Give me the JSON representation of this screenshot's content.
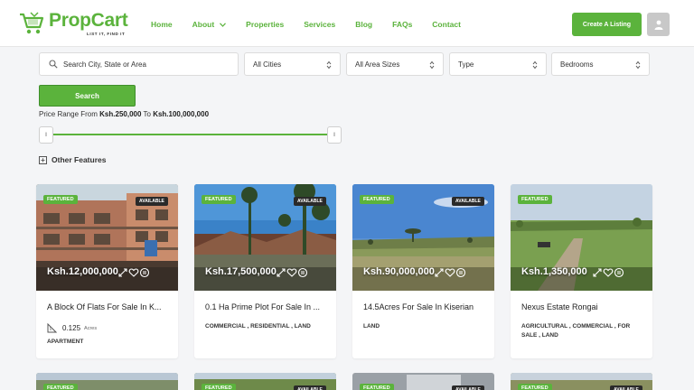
{
  "header": {
    "brand": "PropCart",
    "tagline": "LIST IT, FIND IT",
    "nav": [
      {
        "label": "Home"
      },
      {
        "label": "About"
      },
      {
        "label": "Properties"
      },
      {
        "label": "Services"
      },
      {
        "label": "Blog"
      },
      {
        "label": "FAQs"
      },
      {
        "label": "Contact"
      }
    ],
    "create_listing": "Create A Listing"
  },
  "search": {
    "placeholder": "Search City, State or Area",
    "cities": "All Cities",
    "area_sizes": "All Area Sizes",
    "type": "Type",
    "bedrooms": "Bedrooms",
    "button": "Search",
    "price_prefix": "Price Range From",
    "price_from": "Ksh.250,000",
    "price_mid": "To",
    "price_to": "Ksh.100,000,000",
    "slider_min": 0,
    "slider_max": 1,
    "handle_glyph": "ll",
    "other_features": "Other Features"
  },
  "badges": {
    "featured": "FEATURED",
    "available": "AVAILABLE"
  },
  "listings": [
    {
      "price": "Ksh.12,000,000",
      "title": "A Block Of Flats For Sale In K...",
      "area": "0.125",
      "area_unit": "Acres",
      "type": "APARTMENT",
      "available": true
    },
    {
      "price": "Ksh.17,500,000",
      "title": "0.1 Ha Prime Plot For Sale In ...",
      "type": "COMMERCIAL , RESIDENTIAL , LAND",
      "available": true
    },
    {
      "price": "Ksh.90,000,000",
      "title": "14.5Acres For Sale In Kiserian",
      "type": "LAND",
      "available": true
    },
    {
      "price": "Ksh.1,350,000",
      "title": "Nexus Estate Rongai",
      "type": "AGRICULTURAL , COMMERCIAL , FOR SALE , LAND",
      "available": false
    }
  ],
  "colors": {
    "accent": "#5bb33c",
    "dark_badge": "#2a2a2a"
  }
}
